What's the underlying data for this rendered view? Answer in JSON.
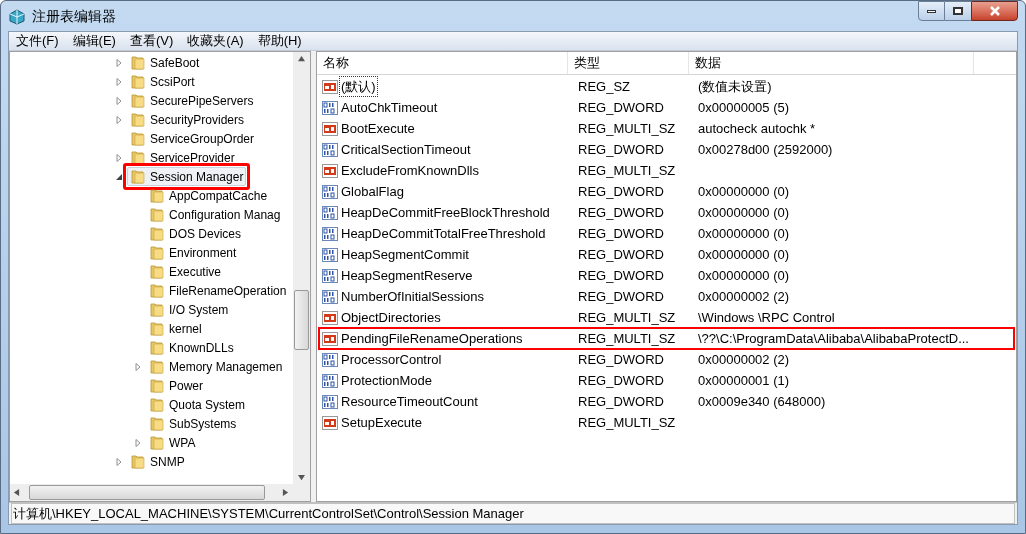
{
  "window": {
    "title": "注册表编辑器"
  },
  "menu": [
    "文件(F)",
    "编辑(E)",
    "查看(V)",
    "收藏夹(A)",
    "帮助(H)"
  ],
  "tree": [
    {
      "label": "SafeBoot",
      "expandable": true,
      "expanded": false,
      "selected": false,
      "annotated": false
    },
    {
      "label": "ScsiPort",
      "expandable": true,
      "expanded": false,
      "selected": false,
      "annotated": false
    },
    {
      "label": "SecurePipeServers",
      "expandable": true,
      "expanded": false,
      "selected": false,
      "annotated": false
    },
    {
      "label": "SecurityProviders",
      "expandable": true,
      "expanded": false,
      "selected": false,
      "annotated": false
    },
    {
      "label": "ServiceGroupOrder",
      "expandable": false,
      "expanded": false,
      "selected": false,
      "annotated": false
    },
    {
      "label": "ServiceProvider",
      "expandable": true,
      "expanded": false,
      "selected": false,
      "annotated": false
    },
    {
      "label": "Session Manager",
      "expandable": true,
      "expanded": true,
      "selected": true,
      "annotated": true,
      "children": [
        {
          "label": "AppCompatCache",
          "expandable": false,
          "expanded": false,
          "selected": false,
          "annotated": false
        },
        {
          "label": "Configuration Manag",
          "expandable": false,
          "expanded": false,
          "selected": false,
          "annotated": false
        },
        {
          "label": "DOS Devices",
          "expandable": false,
          "expanded": false,
          "selected": false,
          "annotated": false
        },
        {
          "label": "Environment",
          "expandable": false,
          "expanded": false,
          "selected": false,
          "annotated": false
        },
        {
          "label": "Executive",
          "expandable": false,
          "expanded": false,
          "selected": false,
          "annotated": false
        },
        {
          "label": "FileRenameOperation",
          "expandable": false,
          "expanded": false,
          "selected": false,
          "annotated": false
        },
        {
          "label": "I/O System",
          "expandable": false,
          "expanded": false,
          "selected": false,
          "annotated": false
        },
        {
          "label": "kernel",
          "expandable": false,
          "expanded": false,
          "selected": false,
          "annotated": false
        },
        {
          "label": "KnownDLLs",
          "expandable": false,
          "expanded": false,
          "selected": false,
          "annotated": false
        },
        {
          "label": "Memory Managemen",
          "expandable": true,
          "expanded": false,
          "selected": false,
          "annotated": false
        },
        {
          "label": "Power",
          "expandable": false,
          "expanded": false,
          "selected": false,
          "annotated": false
        },
        {
          "label": "Quota System",
          "expandable": false,
          "expanded": false,
          "selected": false,
          "annotated": false
        },
        {
          "label": "SubSystems",
          "expandable": false,
          "expanded": false,
          "selected": false,
          "annotated": false
        },
        {
          "label": "WPA",
          "expandable": true,
          "expanded": false,
          "selected": false,
          "annotated": false
        }
      ]
    },
    {
      "label": "SNMP",
      "expandable": true,
      "expanded": false,
      "selected": false,
      "annotated": false
    }
  ],
  "columns": [
    "名称",
    "类型",
    "数据"
  ],
  "rows": [
    {
      "kind": "sz",
      "name": "(默认)",
      "type": "REG_SZ",
      "data": "(数值未设置)",
      "focused": true,
      "annotated": false
    },
    {
      "kind": "dword",
      "name": "AutoChkTimeout",
      "type": "REG_DWORD",
      "data": "0x00000005 (5)",
      "focused": false,
      "annotated": false
    },
    {
      "kind": "sz",
      "name": "BootExecute",
      "type": "REG_MULTI_SZ",
      "data": "autocheck autochk *",
      "focused": false,
      "annotated": false
    },
    {
      "kind": "dword",
      "name": "CriticalSectionTimeout",
      "type": "REG_DWORD",
      "data": "0x00278d00 (2592000)",
      "focused": false,
      "annotated": false
    },
    {
      "kind": "sz",
      "name": "ExcludeFromKnownDlls",
      "type": "REG_MULTI_SZ",
      "focused": false,
      "annotated": false
    },
    {
      "kind": "dword",
      "name": "GlobalFlag",
      "type": "REG_DWORD",
      "data": "0x00000000 (0)",
      "focused": false,
      "annotated": false
    },
    {
      "kind": "dword",
      "name": "HeapDeCommitFreeBlockThreshold",
      "type": "REG_DWORD",
      "data": "0x00000000 (0)",
      "focused": false,
      "annotated": false
    },
    {
      "kind": "dword",
      "name": "HeapDeCommitTotalFreeThreshold",
      "type": "REG_DWORD",
      "data": "0x00000000 (0)",
      "focused": false,
      "annotated": false
    },
    {
      "kind": "dword",
      "name": "HeapSegmentCommit",
      "type": "REG_DWORD",
      "data": "0x00000000 (0)",
      "focused": false,
      "annotated": false
    },
    {
      "kind": "dword",
      "name": "HeapSegmentReserve",
      "type": "REG_DWORD",
      "data": "0x00000000 (0)",
      "focused": false,
      "annotated": false
    },
    {
      "kind": "dword",
      "name": "NumberOfInitialSessions",
      "type": "REG_DWORD",
      "data": "0x00000002 (2)",
      "focused": false,
      "annotated": false
    },
    {
      "kind": "sz",
      "name": "ObjectDirectories",
      "type": "REG_MULTI_SZ",
      "data": "\\Windows \\RPC Control",
      "focused": false,
      "annotated": false
    },
    {
      "kind": "sz",
      "name": "PendingFileRenameOperations",
      "type": "REG_MULTI_SZ",
      "data": "\\??\\C:\\ProgramData\\Alibaba\\AlibabaProtectD...",
      "focused": false,
      "annotated": true
    },
    {
      "kind": "dword",
      "name": "ProcessorControl",
      "type": "REG_DWORD",
      "data": "0x00000002 (2)",
      "focused": false,
      "annotated": false
    },
    {
      "kind": "dword",
      "name": "ProtectionMode",
      "type": "REG_DWORD",
      "data": "0x00000001 (1)",
      "focused": false,
      "annotated": false
    },
    {
      "kind": "dword",
      "name": "ResourceTimeoutCount",
      "type": "REG_DWORD",
      "data": "0x0009e340 (648000)",
      "focused": false,
      "annotated": false
    },
    {
      "kind": "sz",
      "name": "SetupExecute",
      "type": "REG_MULTI_SZ",
      "focused": false,
      "annotated": false
    }
  ],
  "status_bar": "计算机\\HKEY_LOCAL_MACHINE\\SYSTEM\\CurrentControlSet\\Control\\Session Manager"
}
